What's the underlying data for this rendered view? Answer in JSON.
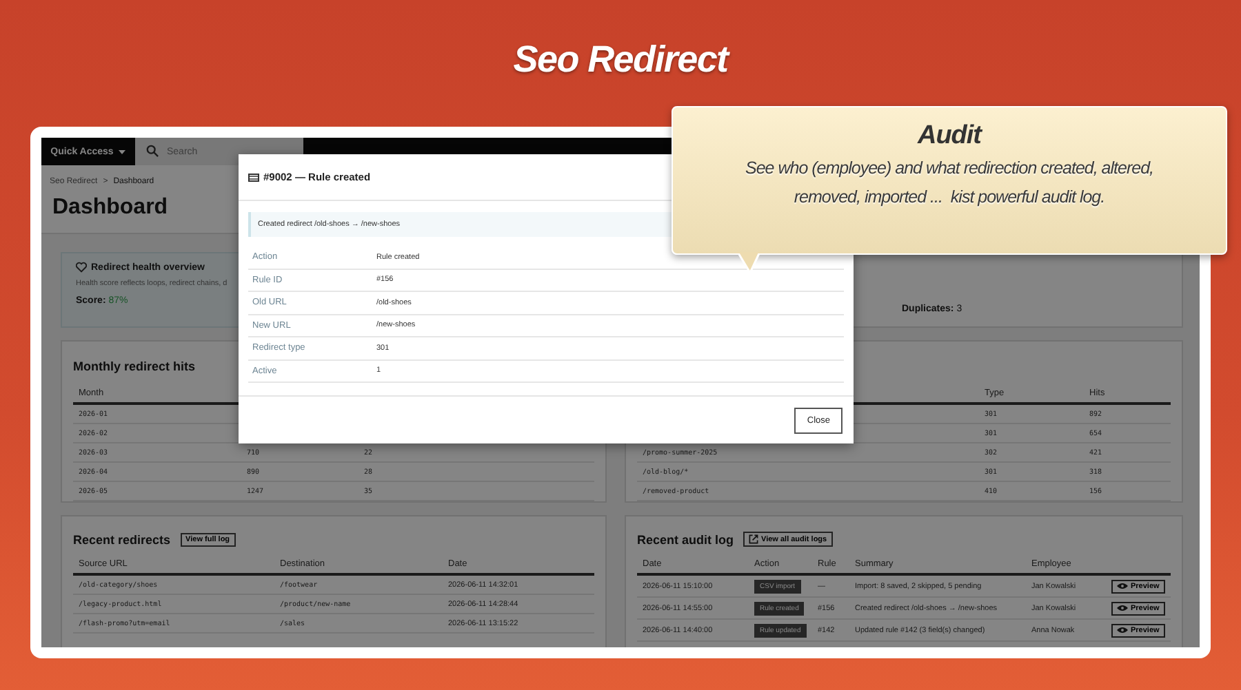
{
  "page_title": "Seo Redirect",
  "callout": {
    "title": "Audit",
    "text": "See who (employee) and what redirection created, altered,\nremoved, imported ...  kist powerful audit log."
  },
  "topbar": {
    "quick_access": "Quick Access",
    "search_placeholder": "Search"
  },
  "breadcrumb": {
    "items": [
      "Seo Redirect",
      "Dashboard"
    ],
    "separator": ">"
  },
  "heading": "Dashboard",
  "health": {
    "title": "Redirect health overview",
    "description": "Health score reflects loops, redirect chains, d",
    "score_label": "Score:",
    "score_value": "87%"
  },
  "stats_card": {
    "label": "Duplicates:",
    "value": "3"
  },
  "monthly": {
    "title": "Monthly redirect hits",
    "columns": {
      "month": "Month"
    },
    "rows": [
      {
        "month": "2026-01"
      },
      {
        "month": "2026-02"
      },
      {
        "month": "2026-03",
        "column_2": "710",
        "column_3": "22"
      },
      {
        "month": "2026-04",
        "column_2": "890",
        "column_3": "28"
      },
      {
        "month": "2026-05",
        "column_2": "1247",
        "column_3": "35"
      }
    ]
  },
  "top_redirects": {
    "columns": {
      "type": "Type",
      "hits": "Hits"
    },
    "rows": [
      {
        "type": "301",
        "hits": "892"
      },
      {
        "type": "301",
        "hits": "654"
      },
      {
        "source": "/promo-summer-2025",
        "type": "302",
        "hits": "421"
      },
      {
        "source": "/old-blog/*",
        "type": "301",
        "hits": "318"
      },
      {
        "source": "/removed-product",
        "type": "410",
        "hits": "156"
      }
    ]
  },
  "recent_redirects": {
    "title": "Recent redirects",
    "button": "View full log",
    "columns": [
      "Source URL",
      "Destination",
      "Date"
    ],
    "rows": [
      [
        "/old-category/shoes",
        "/footwear",
        "2026-06-11 14:32:01"
      ],
      [
        "/legacy-product.html",
        "/product/new-name",
        "2026-06-11 14:28:44"
      ],
      [
        "/flash-promo?utm=email",
        "/sales",
        "2026-06-11 13:15:22"
      ]
    ]
  },
  "audit_log": {
    "title": "Recent audit log",
    "button": "View all audit logs",
    "columns": [
      "Date",
      "Action",
      "Rule",
      "Summary",
      "Employee"
    ],
    "rows": [
      {
        "date": "2026-06-11 15:10:00",
        "action": "CSV import",
        "rule": "—",
        "summary": "Import: 8 saved, 2 skipped, 5 pending",
        "employee": "Jan Kowalski",
        "preview": "Preview"
      },
      {
        "date": "2026-06-11 14:55:00",
        "action": "Rule created",
        "rule": "#156",
        "summary": "Created redirect /old-shoes → /new-shoes",
        "employee": "Jan Kowalski",
        "preview": "Preview"
      },
      {
        "date": "2026-06-11 14:40:00",
        "action": "Rule updated",
        "rule": "#142",
        "summary": "Updated rule #142 (3 field(s) changed)",
        "employee": "Anna Nowak",
        "preview": "Preview"
      }
    ]
  },
  "modal": {
    "title": "#9002 — Rule created",
    "notice": "Created redirect /old-shoes → /new-shoes",
    "fields": [
      {
        "label": "Action",
        "value": "Rule created"
      },
      {
        "label": "Rule ID",
        "value": "#156"
      },
      {
        "label": "Old URL",
        "value": "/old-shoes"
      },
      {
        "label": "New URL",
        "value": "/new-shoes"
      },
      {
        "label": "Redirect type",
        "value": "301"
      },
      {
        "label": "Active",
        "value": "1"
      }
    ],
    "close": "Close"
  }
}
